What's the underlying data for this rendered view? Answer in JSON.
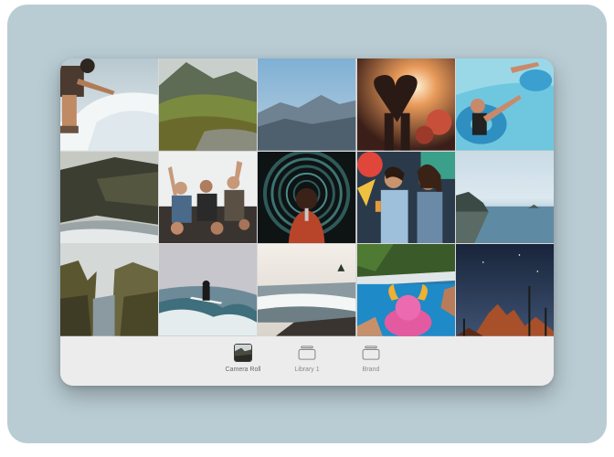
{
  "tabs": [
    {
      "label": "Camera Roll",
      "icon": "camera-roll-thumbnail-icon",
      "active": true
    },
    {
      "label": "Library 1",
      "icon": "folder-icon",
      "active": false
    },
    {
      "label": "Brand",
      "icon": "folder-icon",
      "active": false
    }
  ],
  "photos": [
    "surfer-splash-photo",
    "green-valley-mountains-photo",
    "blue-mountain-range-photo",
    "concert-heart-hands-photo",
    "pool-float-photo",
    "coastal-cliffs-photo",
    "friends-celebrating-photo",
    "singer-spiral-lights-photo",
    "women-mural-drinks-photo",
    "ocean-island-coast-photo",
    "rock-canyon-coast-photo",
    "surfer-wave-photo",
    "beach-waves-photo",
    "pool-inflatable-bull-photo",
    "desert-night-sky-photo"
  ]
}
